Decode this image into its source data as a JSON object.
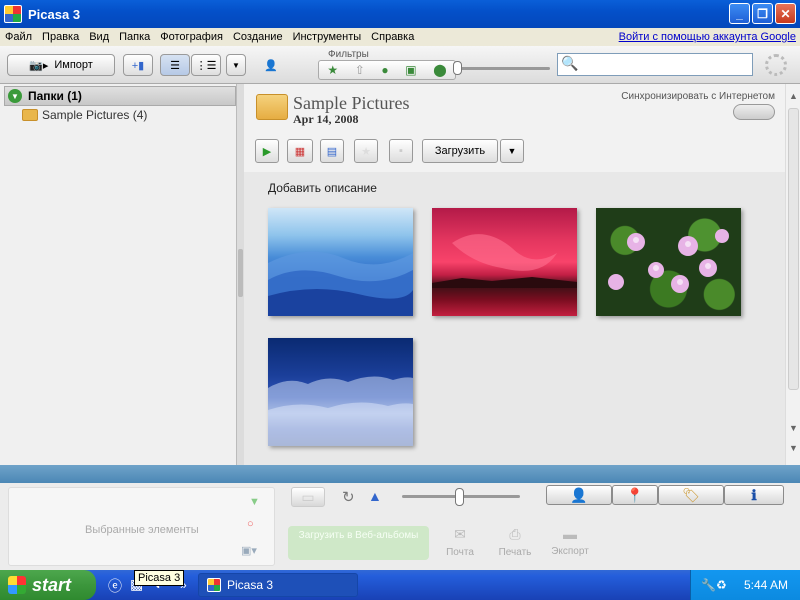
{
  "window": {
    "title": "Picasa 3",
    "controls": [
      "minimize",
      "maximize",
      "close"
    ]
  },
  "menu": {
    "items": [
      "Файл",
      "Правка",
      "Вид",
      "Папка",
      "Фотография",
      "Создание",
      "Инструменты",
      "Справка"
    ],
    "signin_link": "Войти с помощью аккаунта Google"
  },
  "toolbar": {
    "import_label": "Импорт",
    "filters_label": "Фильтры",
    "filter_icons": [
      "star-icon",
      "upload-icon",
      "person-icon",
      "film-icon",
      "pin-icon"
    ],
    "search_value": ""
  },
  "sidebar": {
    "header": "Папки (1)",
    "folders": [
      {
        "label": "Sample Pictures (4)"
      }
    ]
  },
  "album": {
    "title": "Sample Pictures",
    "date": "Apr 14, 2008",
    "sync_label": "Синхронизировать с Интернетом",
    "upload_label": "Загрузить",
    "description_placeholder": "Добавить описание",
    "photos": [
      {
        "name": "blue-hills-photo"
      },
      {
        "name": "sunset-photo"
      },
      {
        "name": "water-lilies-photo"
      },
      {
        "name": "winter-photo"
      }
    ]
  },
  "bottom": {
    "selection_label": "Выбранные элементы",
    "actions": [
      "Загрузить в Веб-альбомы",
      "Почта",
      "Печать",
      "Экспорт"
    ]
  },
  "taskbar": {
    "start_label": "start",
    "tooltip": "Picasa 3",
    "task_label": "Picasa 3",
    "clock": "5:44 AM"
  }
}
